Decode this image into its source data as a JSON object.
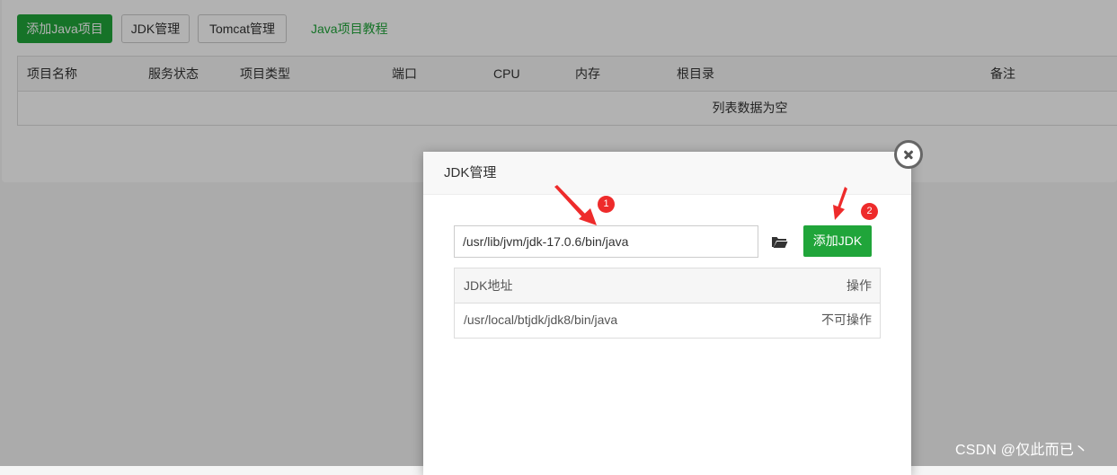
{
  "toolbar": {
    "add_project_label": "添加Java项目",
    "jdk_manage_label": "JDK管理",
    "tomcat_manage_label": "Tomcat管理",
    "tutorial_link": "Java项目教程"
  },
  "project_table": {
    "columns": [
      "项目名称",
      "服务状态",
      "项目类型",
      "端口",
      "CPU",
      "内存",
      "根目录",
      "备注"
    ],
    "empty_text": "列表数据为空"
  },
  "modal": {
    "title": "JDK管理",
    "path_value": "/usr/lib/jvm/jdk-17.0.6/bin/java",
    "add_jdk_label": "添加JDK",
    "table": {
      "headers": [
        "JDK地址",
        "操作"
      ],
      "rows": [
        {
          "path": "/usr/local/btjdk/jdk8/bin/java",
          "action": "不可操作"
        }
      ]
    }
  },
  "annotations": {
    "badge1": "1",
    "badge2": "2"
  },
  "watermark": "CSDN @仅此而已丶",
  "colors": {
    "accent_green": "#20a53a",
    "annotation_red": "#ee2b2b"
  },
  "icons": {
    "close": "close-icon",
    "folder": "folder-open-icon"
  }
}
